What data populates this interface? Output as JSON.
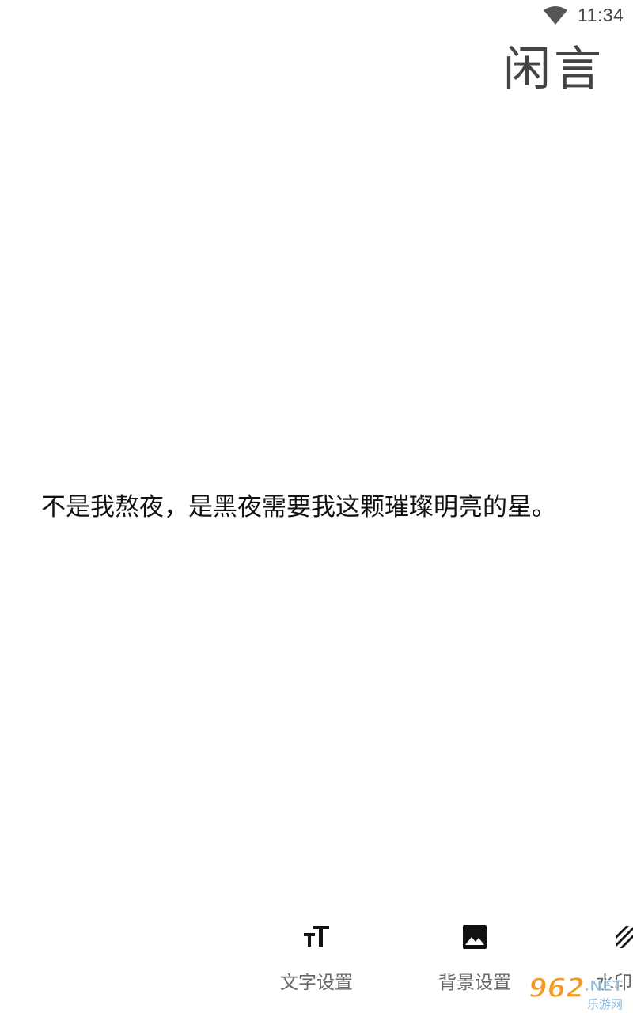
{
  "status_bar": {
    "time": "11:34",
    "icons": [
      "wifi-icon"
    ]
  },
  "app": {
    "title": "闲言"
  },
  "quote": {
    "text": "不是我熬夜，是黑夜需要我这颗璀璨明亮的星。"
  },
  "toolbar": {
    "items": [
      {
        "label": "文字设置",
        "icon": "text-size-icon"
      },
      {
        "label": "背景设置",
        "icon": "image-icon"
      },
      {
        "label": "水印",
        "icon": "watermark-icon"
      }
    ]
  },
  "site_logo": {
    "number": "962",
    "suffix": ".NET",
    "caption": "乐游网"
  },
  "colors": {
    "background": "#ffffff",
    "text": "#111111",
    "label": "#666666",
    "logo_orange": "#f59a23"
  }
}
